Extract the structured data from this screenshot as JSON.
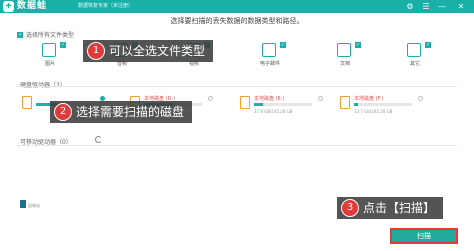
{
  "app": {
    "logo_glyph": "✚",
    "name": "数据蛙",
    "subtitle": "数据恢复专家（未注册）",
    "window_controls": [
      "⚙",
      "☰",
      "—",
      "✕"
    ]
  },
  "headline": "选择要扫描的丢失数据的数据类型和路径。",
  "select_all": {
    "label": "选择所有文件类型",
    "checked": true
  },
  "file_types": [
    {
      "label": "图片",
      "checked": true
    },
    {
      "label": "音频",
      "checked": true
    },
    {
      "label": "视频",
      "checked": true
    },
    {
      "label": "电子邮件",
      "checked": true
    },
    {
      "label": "文档",
      "checked": true
    },
    {
      "label": "其它",
      "checked": true
    }
  ],
  "hard_drives": {
    "label": "硬盘驱动器（3）",
    "drives": [
      {
        "name": "",
        "size": "",
        "usage": 0.45,
        "selected": true
      },
      {
        "name": "本地磁盘 (D:)",
        "size": "",
        "usage": 0.5,
        "selected": false
      },
      {
        "name": "本地磁盘 (E:)",
        "size": "27.8 GB/195.28 GB",
        "usage": 0.15,
        "selected": false
      },
      {
        "name": "本地磁盘 (F:)",
        "size": "13.7 GB/195.28 GB",
        "usage": 0.07,
        "selected": false
      }
    ]
  },
  "removable": {
    "label": "可移动驱动器（0）"
  },
  "bottom_item": {
    "label": "回收站"
  },
  "scan_button": {
    "label": "扫描"
  },
  "callouts": [
    {
      "number": "1",
      "text": "可以全选文件类型"
    },
    {
      "number": "2",
      "text": "选择需要扫描的磁盘"
    },
    {
      "number": "3",
      "text": "点击【扫描】"
    }
  ],
  "colors": {
    "brand": "#19b0a8",
    "callout_number": "#e23a3a",
    "drive_icon": "#f0a030"
  }
}
